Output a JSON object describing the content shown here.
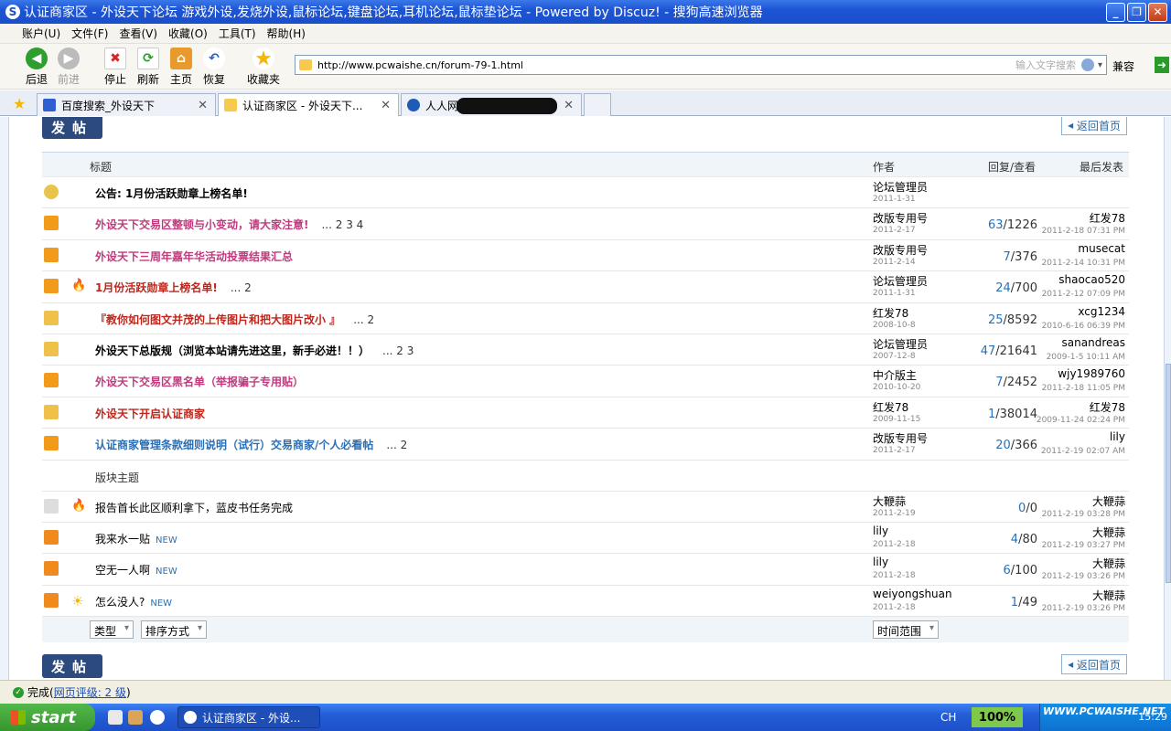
{
  "window": {
    "title": "认证商家区 - 外设天下论坛 游戏外设,发烧外设,鼠标论坛,键盘论坛,耳机论坛,鼠标垫论坛 - Powered by Discuz! - 搜狗高速浏览器",
    "app_icon": "S"
  },
  "menu": [
    "账户(U)",
    "文件(F)",
    "查看(V)",
    "收藏(O)",
    "工具(T)",
    "帮助(H)"
  ],
  "toolbar": {
    "back": "后退",
    "forward": "前进",
    "stop": "停止",
    "refresh": "刷新",
    "home": "主页",
    "restore": "恢复",
    "favorites": "收藏夹",
    "url": "http://www.pcwaishe.cn/forum-79-1.html",
    "search_placeholder": "输入文字搜索",
    "compat": "兼容"
  },
  "tabs": [
    {
      "label": "百度搜索_外设天下"
    },
    {
      "label": "认证商家区 - 外设天下..."
    },
    {
      "label": "人人网"
    }
  ],
  "forum": {
    "post_label": "发帖",
    "home_label": "返回首页",
    "headers": {
      "title": "标题",
      "author": "作者",
      "reply": "回复/查看",
      "last": "最后发表"
    },
    "section_label": "版块主题",
    "filters": {
      "type": "类型",
      "sort": "排序方式",
      "time": "时间范围"
    },
    "pinned": [
      {
        "title": "公告: 1月份活跃勋章上榜名单!",
        "color": "blk",
        "pages": "",
        "author": "论坛管理员",
        "adate": "2011-1-31",
        "reply": "",
        "views": "",
        "last": "",
        "ldate": ""
      },
      {
        "title": "外设天下交易区整顿与小变动，请大家注意!",
        "color": "magenta",
        "pages": "... 2 3 4",
        "author": "改版专用号",
        "adate": "2011-2-17",
        "reply": "63",
        "views": "1226",
        "last": "红发78",
        "ldate": "2011-2-18 07:31 PM"
      },
      {
        "title": "外设天下三周年嘉年华活动投票结果汇总",
        "color": "magenta",
        "pages": "",
        "author": "改版专用号",
        "adate": "2011-2-14",
        "reply": "7",
        "views": "376",
        "last": "musecat",
        "ldate": "2011-2-14 10:31 PM"
      },
      {
        "title": "1月份活跃勋章上榜名单!",
        "color": "red",
        "pages": "... 2",
        "author": "论坛管理员",
        "adate": "2011-1-31",
        "reply": "24",
        "views": "700",
        "last": "shaocao520",
        "ldate": "2011-2-12 07:09 PM"
      },
      {
        "title": "『教你如何图文并茂的上传图片和把大图片改小 』",
        "color": "red",
        "pages": "... 2",
        "author": "红发78",
        "adate": "2008-10-8",
        "reply": "25",
        "views": "8592",
        "last": "xcg1234",
        "ldate": "2010-6-16 06:39 PM"
      },
      {
        "title": "外设天下总版规（浏览本站请先进这里，新手必进！！）",
        "color": "blk",
        "pages": "... 2 3",
        "author": "论坛管理员",
        "adate": "2007-12-8",
        "reply": "47",
        "views": "21641",
        "last": "sanandreas",
        "ldate": "2009-1-5 10:11 AM"
      },
      {
        "title": "外设天下交易区黑名单（举报骗子专用贴）",
        "color": "magenta",
        "pages": "",
        "author": "中介版主",
        "adate": "2010-10-20",
        "reply": "7",
        "views": "2452",
        "last": "wjy1989760",
        "ldate": "2011-2-18 11:05 PM"
      },
      {
        "title": "外设天下开启认证商家",
        "color": "red",
        "pages": "",
        "author": "红发78",
        "adate": "2009-11-15",
        "reply": "1",
        "views": "38014",
        "last": "红发78",
        "ldate": "2009-11-24 02:24 PM"
      },
      {
        "title": "认证商家管理条款细则说明（试行）交易商家/个人必看帖",
        "color": "blue",
        "pages": "... 2",
        "author": "改版专用号",
        "adate": "2011-2-17",
        "reply": "20",
        "views": "366",
        "last": "lily",
        "ldate": "2011-2-19 02:07 AM"
      }
    ],
    "normal": [
      {
        "title": "报告首长此区顺利拿下，蓝皮书任务完成",
        "new": "",
        "author": "大鞭蒜",
        "adate": "2011-2-19",
        "reply": "0",
        "views": "0",
        "last": "大鞭蒜",
        "ldate": "2011-2-19 03:28 PM"
      },
      {
        "title": "我来水一贴",
        "new": "NEW",
        "author": "lily",
        "adate": "2011-2-18",
        "reply": "4",
        "views": "80",
        "last": "大鞭蒜",
        "ldate": "2011-2-19 03:27 PM"
      },
      {
        "title": "空无一人啊",
        "new": "NEW",
        "author": "lily",
        "adate": "2011-2-18",
        "reply": "6",
        "views": "100",
        "last": "大鞭蒜",
        "ldate": "2011-2-19 03:26 PM"
      },
      {
        "title": "怎么没人?",
        "new": "NEW",
        "author": "weiyongshuan",
        "adate": "2011-2-18",
        "reply": "1",
        "views": "49",
        "last": "大鞭蒜",
        "ldate": "2011-2-19 03:26 PM"
      }
    ]
  },
  "status": {
    "done": "完成",
    "rating": "网页评级: 2 级"
  },
  "taskbar": {
    "start": "start",
    "task": "认证商家区 - 外设...",
    "lang": "CH",
    "zoom": "100%",
    "time": "15:29",
    "watermark": "WWW.PCWAISHE.NET"
  }
}
